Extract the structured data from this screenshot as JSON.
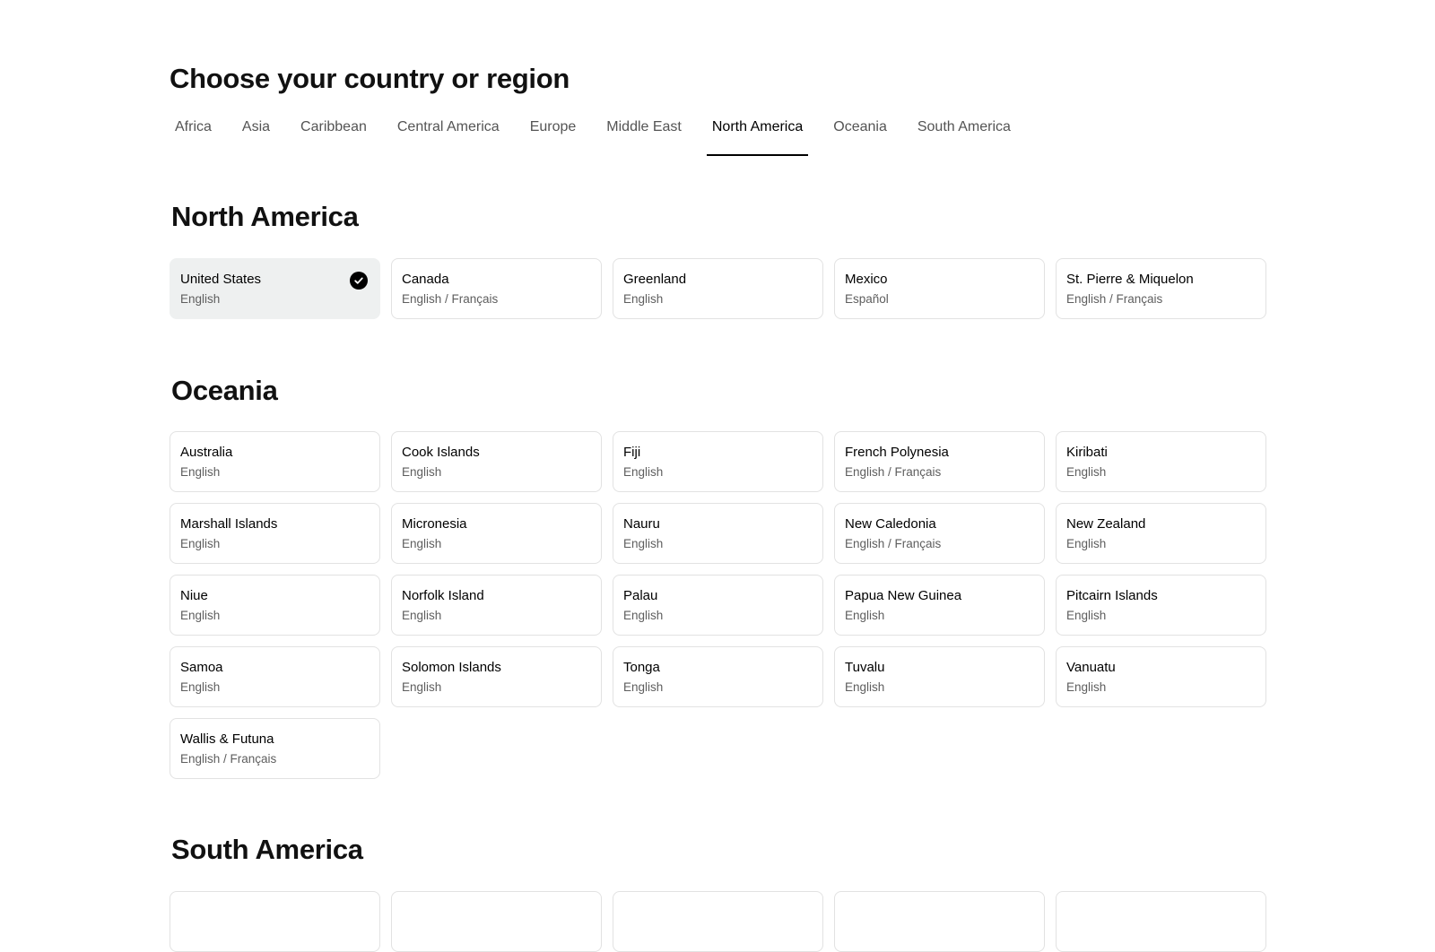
{
  "page_title": "Choose your country or region",
  "tabs": [
    {
      "label": "Africa",
      "active": false
    },
    {
      "label": "Asia",
      "active": false
    },
    {
      "label": "Caribbean",
      "active": false
    },
    {
      "label": "Central America",
      "active": false
    },
    {
      "label": "Europe",
      "active": false
    },
    {
      "label": "Middle East",
      "active": false
    },
    {
      "label": "North America",
      "active": true
    },
    {
      "label": "Oceania",
      "active": false
    },
    {
      "label": "South America",
      "active": false
    }
  ],
  "sections": {
    "north_america": {
      "title": "North America",
      "countries": [
        {
          "name": "United States",
          "language": "English",
          "selected": true
        },
        {
          "name": "Canada",
          "language": "English / Français"
        },
        {
          "name": "Greenland",
          "language": "English"
        },
        {
          "name": "Mexico",
          "language": "Español"
        },
        {
          "name": "St. Pierre & Miquelon",
          "language": "English / Français"
        }
      ]
    },
    "oceania": {
      "title": "Oceania",
      "countries": [
        {
          "name": "Australia",
          "language": "English"
        },
        {
          "name": "Cook Islands",
          "language": "English"
        },
        {
          "name": "Fiji",
          "language": "English"
        },
        {
          "name": "French Polynesia",
          "language": "English / Français"
        },
        {
          "name": "Kiribati",
          "language": "English"
        },
        {
          "name": "Marshall Islands",
          "language": "English"
        },
        {
          "name": "Micronesia",
          "language": "English"
        },
        {
          "name": "Nauru",
          "language": "English"
        },
        {
          "name": "New Caledonia",
          "language": "English / Français"
        },
        {
          "name": "New Zealand",
          "language": "English"
        },
        {
          "name": "Niue",
          "language": "English"
        },
        {
          "name": "Norfolk Island",
          "language": "English"
        },
        {
          "name": "Palau",
          "language": "English"
        },
        {
          "name": "Papua New Guinea",
          "language": "English"
        },
        {
          "name": "Pitcairn Islands",
          "language": "English"
        },
        {
          "name": "Samoa",
          "language": "English"
        },
        {
          "name": "Solomon Islands",
          "language": "English"
        },
        {
          "name": "Tonga",
          "language": "English"
        },
        {
          "name": "Tuvalu",
          "language": "English"
        },
        {
          "name": "Vanuatu",
          "language": "English"
        },
        {
          "name": "Wallis & Futuna",
          "language": "English / Français"
        }
      ]
    },
    "south_america": {
      "title": "South America"
    }
  },
  "icons": {
    "selected_check": "check-circle-icon"
  },
  "colors": {
    "selected_card_bg": "#eef0f0",
    "card_border": "#e2e2e2",
    "accent": "#000000"
  }
}
